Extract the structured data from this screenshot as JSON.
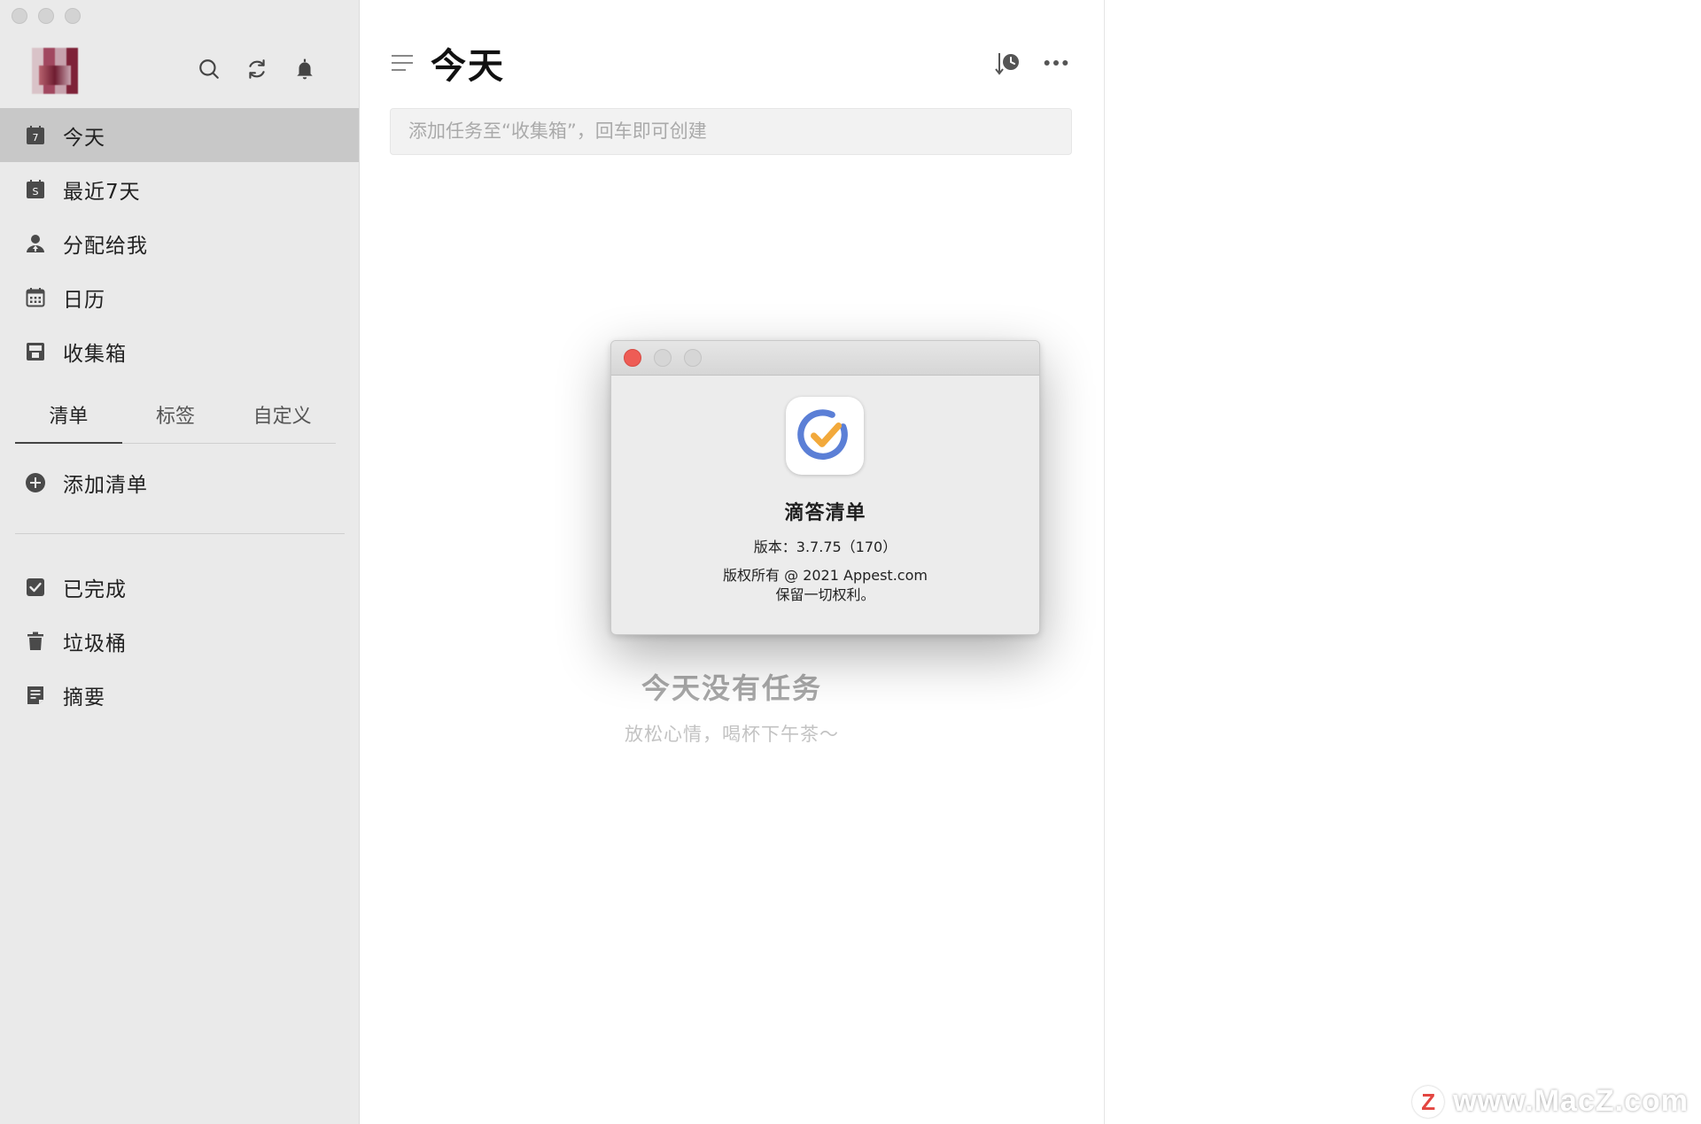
{
  "sidebar": {
    "smart_lists": [
      {
        "label": "今天",
        "icon": "calendar-today-icon",
        "active": true
      },
      {
        "label": "最近7天",
        "icon": "calendar-week-icon"
      },
      {
        "label": "分配给我",
        "icon": "person-icon"
      },
      {
        "label": "日历",
        "icon": "calendar-grid-icon"
      },
      {
        "label": "收集箱",
        "icon": "inbox-icon"
      }
    ],
    "today_icon_text": "7",
    "week_icon_text": "S",
    "tabs": [
      {
        "label": "清单",
        "active": true
      },
      {
        "label": "标签"
      },
      {
        "label": "自定义"
      }
    ],
    "add_list_label": "添加清单",
    "bottom_items": [
      {
        "label": "已完成",
        "icon": "checkbox-icon"
      },
      {
        "label": "垃圾桶",
        "icon": "trash-icon"
      },
      {
        "label": "摘要",
        "icon": "summary-icon"
      }
    ]
  },
  "main": {
    "title": "今天",
    "task_input_placeholder": "添加任务至“收集箱”，回车即可创建",
    "empty_title": "今天没有任务",
    "empty_subtitle": "放松心情，喝杯下午茶～"
  },
  "about_dialog": {
    "app_name": "滴答清单",
    "version": "版本：3.7.75（170）",
    "copyright_line1": "版权所有 @ 2021 Appest.com",
    "copyright_line2": "保留一切权利。"
  },
  "watermark": {
    "letter": "Z",
    "text": "www.MacZ.com"
  },
  "colors": {
    "sidebar_bg": "#eaeaea",
    "active_item_bg": "#c8c8c8",
    "close_button": "#ee5c55",
    "logo_blue": "#5b7fd6",
    "logo_orange": "#f2a93b"
  }
}
